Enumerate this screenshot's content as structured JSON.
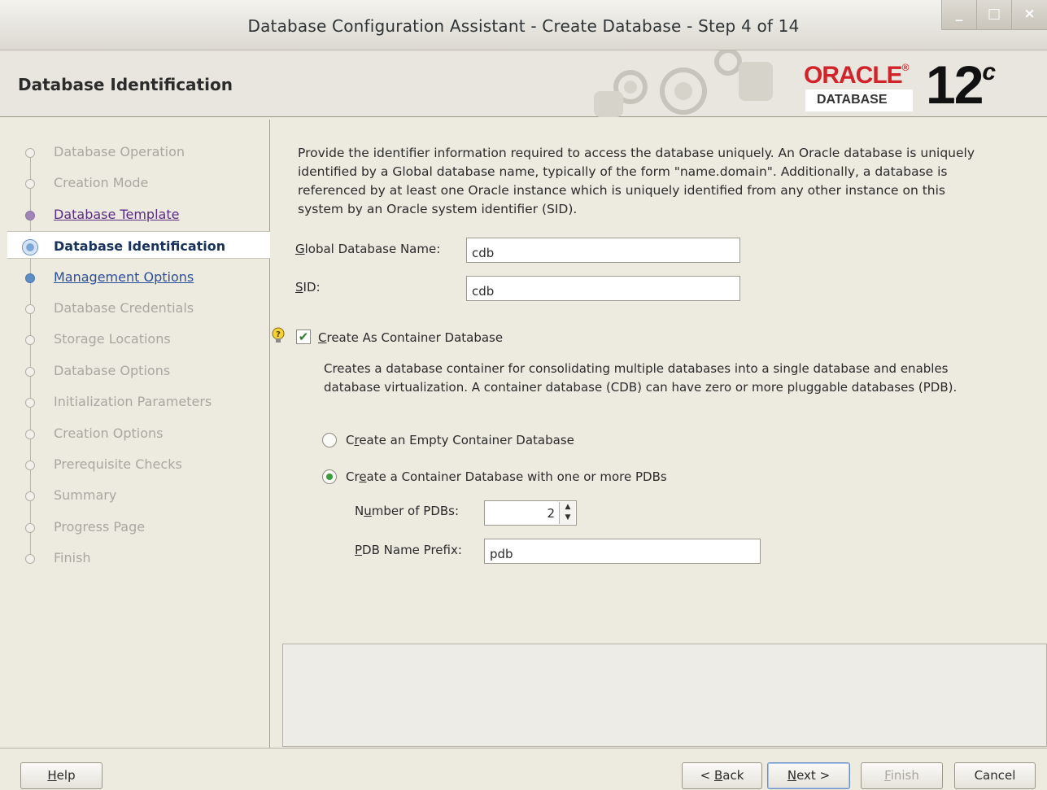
{
  "window": {
    "title": "Database Configuration Assistant - Create Database - Step 4 of 14",
    "minimize_glyph": "_",
    "maximize_glyph": "□",
    "close_glyph": "×"
  },
  "header": {
    "page_heading": "Database Identification",
    "logo_oracle": "ORACLE",
    "logo_database": "DATABASE",
    "logo_version": "12",
    "logo_version_suffix": "c",
    "logo_registered": "®"
  },
  "steps": [
    {
      "label": "Database Operation",
      "state": "disabled"
    },
    {
      "label": "Creation Mode",
      "state": "disabled"
    },
    {
      "label": "Database Template",
      "state": "done"
    },
    {
      "label": "Database Identification",
      "state": "current"
    },
    {
      "label": "Management Options",
      "state": "next"
    },
    {
      "label": "Database Credentials",
      "state": "disabled"
    },
    {
      "label": "Storage Locations",
      "state": "disabled"
    },
    {
      "label": "Database Options",
      "state": "disabled"
    },
    {
      "label": "Initialization Parameters",
      "state": "disabled"
    },
    {
      "label": "Creation Options",
      "state": "disabled"
    },
    {
      "label": "Prerequisite Checks",
      "state": "disabled"
    },
    {
      "label": "Summary",
      "state": "disabled"
    },
    {
      "label": "Progress Page",
      "state": "disabled"
    },
    {
      "label": "Finish",
      "state": "disabled"
    }
  ],
  "form": {
    "description": "Provide the identifier information required to access the database uniquely. An Oracle database is uniquely identified by a Global database name, typically of the form \"name.domain\". Additionally, a database is referenced by at least one Oracle instance which is uniquely identified from any other instance on this system by an Oracle system identifier (SID).",
    "global_db_name_label_mnemonic": "G",
    "global_db_name_label_rest": "lobal Database Name:",
    "global_db_name_value": "cdb",
    "sid_label_mnemonic": "S",
    "sid_label_rest": "ID:",
    "sid_value": "cdb",
    "container_checkbox_mnemonic": "C",
    "container_checkbox_rest": "reate As Container Database",
    "container_checked": true,
    "container_description": "Creates a database container for consolidating multiple databases into a single database and enables database virtualization. A container database (CDB) can have zero or more pluggable databases (PDB).",
    "radio_empty_pre": "C",
    "radio_empty_mnemonic": "r",
    "radio_empty_rest": "eate an Empty Container Database",
    "radio_pdbs_pre": "Cr",
    "radio_pdbs_mnemonic": "e",
    "radio_pdbs_rest": "ate a Container Database with one or more PDBs",
    "selected_radio": "pdbs",
    "num_pdbs_label_pre": "N",
    "num_pdbs_label_mnemonic": "u",
    "num_pdbs_label_rest": "mber of PDBs:",
    "num_pdbs_value": "2",
    "pdb_prefix_label_mnemonic": "P",
    "pdb_prefix_label_rest": "DB Name Prefix:",
    "pdb_prefix_value": "pdb"
  },
  "footer": {
    "help_mnemonic": "H",
    "help_rest": "elp",
    "back_pre": "< ",
    "back_mnemonic": "B",
    "back_rest": "ack",
    "next_mnemonic": "N",
    "next_rest": "ext >",
    "finish_mnemonic": "F",
    "finish_rest": "inish",
    "cancel_label": "Cancel"
  },
  "colors": {
    "oracle_red": "#d2232a",
    "done_step": "#5a2d82",
    "next_step": "#2a4f9a",
    "disabled_text": "#a9a7a0"
  }
}
